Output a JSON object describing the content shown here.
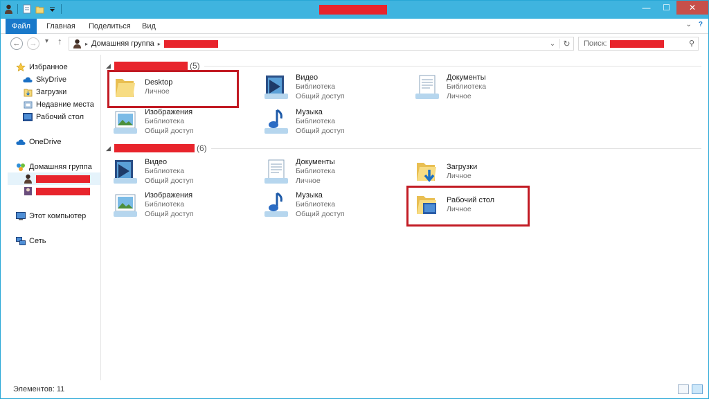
{
  "titlebar": {
    "qat_icons": [
      "user-icon",
      "properties-icon",
      "new-folder-icon",
      "customize-qat-icon"
    ],
    "controls": {
      "minimize": "—",
      "maximize": "☐",
      "close": "✕"
    }
  },
  "ribbon": {
    "tabs": [
      {
        "label": "Файл"
      },
      {
        "label": "Главная"
      },
      {
        "label": "Поделиться"
      },
      {
        "label": "Вид"
      }
    ],
    "collapse_glyph": "⌄",
    "help_glyph": "?"
  },
  "address": {
    "back_glyph": "←",
    "forward_glyph": "→",
    "recent_glyph": "▾",
    "up_glyph": "↑",
    "separator": "▸",
    "crumb": "Домашняя группа",
    "dropdown_glyph": "⌄",
    "refresh_glyph": "↻"
  },
  "search": {
    "label": "Поиск:",
    "icon": "search-icon",
    "glyph": "⚲"
  },
  "sidebar": {
    "favorites": {
      "label": "Избранное",
      "items": [
        {
          "label": "SkyDrive",
          "icon": "skydrive-icon"
        },
        {
          "label": "Загрузки",
          "icon": "downloads-icon"
        },
        {
          "label": "Недавние места",
          "icon": "recent-places-icon"
        },
        {
          "label": "Рабочий стол",
          "icon": "desktop-icon"
        }
      ]
    },
    "onedrive": {
      "label": "OneDrive"
    },
    "homegroup": {
      "label": "Домашняя группа"
    },
    "computer": {
      "label": "Этот компьютер"
    },
    "network": {
      "label": "Сеть"
    }
  },
  "groups": [
    {
      "count": "(5)",
      "items": [
        {
          "name": "Desktop",
          "line2": "Личное",
          "line3": "",
          "icon": "folder-icon"
        },
        {
          "name": "Видео",
          "line2": "Библиотека",
          "line3": "Общий доступ",
          "icon": "video-library-icon"
        },
        {
          "name": "Документы",
          "line2": "Библиотека",
          "line3": "Личное",
          "icon": "documents-library-icon"
        },
        {
          "name": "Изображения",
          "line2": "Библиотека",
          "line3": "Общий доступ",
          "icon": "pictures-library-icon"
        },
        {
          "name": "Музыка",
          "line2": "Библиотека",
          "line3": "Общий доступ",
          "icon": "music-library-icon"
        }
      ]
    },
    {
      "count": "(6)",
      "items": [
        {
          "name": "Видео",
          "line2": "Библиотека",
          "line3": "Общий доступ",
          "icon": "video-library-icon"
        },
        {
          "name": "Документы",
          "line2": "Библиотека",
          "line3": "Личное",
          "icon": "documents-library-icon"
        },
        {
          "name": "Загрузки",
          "line2": "Личное",
          "line3": "",
          "icon": "downloads-folder-icon"
        },
        {
          "name": "Изображения",
          "line2": "Библиотека",
          "line3": "Общий доступ",
          "icon": "pictures-library-icon"
        },
        {
          "name": "Музыка",
          "line2": "Библиотека",
          "line3": "Общий доступ",
          "icon": "music-library-icon"
        },
        {
          "name": "Рабочий стол",
          "line2": "Личное",
          "line3": "",
          "icon": "desktop-folder-icon"
        }
      ]
    }
  ],
  "status": {
    "count_text": "Элементов: 11",
    "view_icons": [
      "details-view-icon",
      "tiles-view-icon"
    ]
  },
  "colors": {
    "accent": "#1979ca",
    "titlebar": "#3fb4df",
    "redaction": "#e8242c",
    "highlight": "#c21b24"
  }
}
